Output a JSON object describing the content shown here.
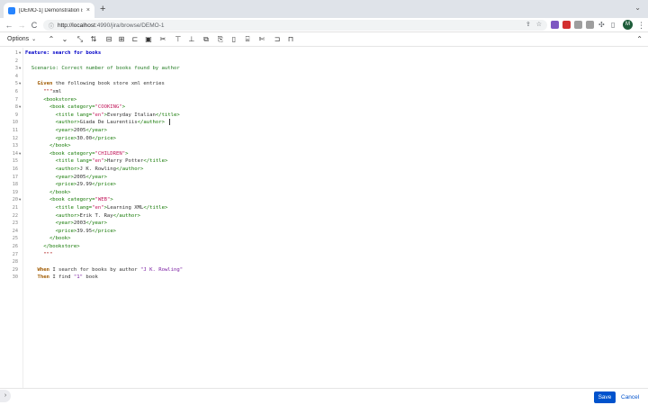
{
  "browser": {
    "tab_title": "[DEMO-1] Demonstration issu...",
    "tab_close": "×",
    "new_tab": "+",
    "window_control": "⌄",
    "url_host": "http://localhost",
    "url_rest": ":4990/jira/browse/DEMO-1",
    "nav": {
      "back": "←",
      "forward": "→",
      "reload": "C"
    },
    "profile_initial": "M",
    "extension_colors": [
      "#7e57c2",
      "#d32f2f",
      "#9e9e9e",
      "#9e9e9e"
    ]
  },
  "toolbar": {
    "options_label": "Options",
    "options_caret": "⌄",
    "buttons": [
      {
        "name": "move-up-icon",
        "glyph": "⌃"
      },
      {
        "name": "move-down-icon",
        "glyph": "⌄"
      },
      {
        "name": "indent-icon",
        "glyph": "⤡"
      },
      {
        "name": "sort-icon",
        "glyph": "⇅"
      },
      {
        "name": "table-icon",
        "glyph": "⊟"
      },
      {
        "name": "table-add-icon",
        "glyph": "⊞"
      },
      {
        "name": "table-row-icon",
        "glyph": "⊏"
      },
      {
        "name": "save-table-icon",
        "glyph": "▣"
      },
      {
        "name": "cut-icon",
        "glyph": "✂"
      },
      {
        "name": "format-icon",
        "glyph": "⊤"
      },
      {
        "name": "align-icon",
        "glyph": "⊥"
      },
      {
        "name": "copy-icon",
        "glyph": "⧉"
      },
      {
        "name": "paste-icon",
        "glyph": "⎘"
      },
      {
        "name": "document-icon",
        "glyph": "▯"
      },
      {
        "name": "clipboard-icon",
        "glyph": "⌸"
      },
      {
        "name": "scissors-icon",
        "glyph": "✄"
      },
      {
        "name": "bracket-icon",
        "glyph": "⊐"
      },
      {
        "name": "insert-icon",
        "glyph": "⊓"
      }
    ],
    "collapse": "⌃"
  },
  "code_lines": [
    [
      {
        "t": "Feature: search for books",
        "c": "kw-feature"
      }
    ],
    [],
    [
      {
        "t": "  Scenario: Correct number of books found by author",
        "c": "kw-scenario"
      }
    ],
    [],
    [
      {
        "t": "    Given",
        "c": "kw-step"
      },
      {
        "t": " the following book store xml entries"
      }
    ],
    [
      {
        "t": "      \"\"\"",
        "c": "str"
      },
      {
        "t": "xml"
      }
    ],
    [
      {
        "t": "      <bookstore>",
        "c": "tag"
      }
    ],
    [
      {
        "t": "        <book category=",
        "c": "tag"
      },
      {
        "t": "\"COOKING\"",
        "c": "attrv"
      },
      {
        "t": ">",
        "c": "tag"
      }
    ],
    [
      {
        "t": "          <title lang=",
        "c": "tag"
      },
      {
        "t": "\"en\"",
        "c": "attrv"
      },
      {
        "t": ">",
        "c": "tag"
      },
      {
        "t": "Everyday Italian"
      },
      {
        "t": "</title>",
        "c": "tag"
      }
    ],
    [
      {
        "t": "          <author>",
        "c": "tag"
      },
      {
        "t": "Giada De Laurentiis"
      },
      {
        "t": "</author>",
        "c": "tag"
      }
    ],
    [
      {
        "t": "          <year>",
        "c": "tag"
      },
      {
        "t": "2005"
      },
      {
        "t": "</year>",
        "c": "tag"
      }
    ],
    [
      {
        "t": "          <price>",
        "c": "tag"
      },
      {
        "t": "30.00"
      },
      {
        "t": "</price>",
        "c": "tag"
      }
    ],
    [
      {
        "t": "        </book>",
        "c": "tag"
      }
    ],
    [
      {
        "t": "        <book category=",
        "c": "tag"
      },
      {
        "t": "\"CHILDREN\"",
        "c": "attrv"
      },
      {
        "t": ">",
        "c": "tag"
      }
    ],
    [
      {
        "t": "          <title lang=",
        "c": "tag"
      },
      {
        "t": "\"en\"",
        "c": "attrv"
      },
      {
        "t": ">",
        "c": "tag"
      },
      {
        "t": "Harry Potter"
      },
      {
        "t": "</title>",
        "c": "tag"
      }
    ],
    [
      {
        "t": "          <author>",
        "c": "tag"
      },
      {
        "t": "J K. Rowling"
      },
      {
        "t": "</author>",
        "c": "tag"
      }
    ],
    [
      {
        "t": "          <year>",
        "c": "tag"
      },
      {
        "t": "2005"
      },
      {
        "t": "</year>",
        "c": "tag"
      }
    ],
    [
      {
        "t": "          <price>",
        "c": "tag"
      },
      {
        "t": "29.99"
      },
      {
        "t": "</price>",
        "c": "tag"
      }
    ],
    [
      {
        "t": "        </book>",
        "c": "tag"
      }
    ],
    [
      {
        "t": "        <book category=",
        "c": "tag"
      },
      {
        "t": "\"WEB\"",
        "c": "attrv"
      },
      {
        "t": ">",
        "c": "tag"
      }
    ],
    [
      {
        "t": "          <title lang=",
        "c": "tag"
      },
      {
        "t": "\"en\"",
        "c": "attrv"
      },
      {
        "t": ">",
        "c": "tag"
      },
      {
        "t": "Learning XML"
      },
      {
        "t": "</title>",
        "c": "tag"
      }
    ],
    [
      {
        "t": "          <author>",
        "c": "tag"
      },
      {
        "t": "Erik T. Ray"
      },
      {
        "t": "</author>",
        "c": "tag"
      }
    ],
    [
      {
        "t": "          <year>",
        "c": "tag"
      },
      {
        "t": "2003"
      },
      {
        "t": "</year>",
        "c": "tag"
      }
    ],
    [
      {
        "t": "          <price>",
        "c": "tag"
      },
      {
        "t": "39.95"
      },
      {
        "t": "</price>",
        "c": "tag"
      }
    ],
    [
      {
        "t": "        </book>",
        "c": "tag"
      }
    ],
    [
      {
        "t": "      </bookstore>",
        "c": "tag"
      }
    ],
    [
      {
        "t": "      \"\"\"",
        "c": "str"
      }
    ],
    [],
    [
      {
        "t": "    When",
        "c": "kw-step"
      },
      {
        "t": " I search for books by author "
      },
      {
        "t": "\"J K. Rowling\"",
        "c": "param"
      }
    ],
    [
      {
        "t": "    Then",
        "c": "kw-step"
      },
      {
        "t": " I find "
      },
      {
        "t": "\"1\"",
        "c": "param"
      },
      {
        "t": " book"
      }
    ]
  ],
  "fold_lines": [
    1,
    3,
    5,
    8,
    14,
    20
  ],
  "fold_glyph": "▾",
  "cursor_line": 10,
  "footer": {
    "save_label": "Save",
    "cancel_label": "Cancel",
    "side_toggle": "›"
  }
}
